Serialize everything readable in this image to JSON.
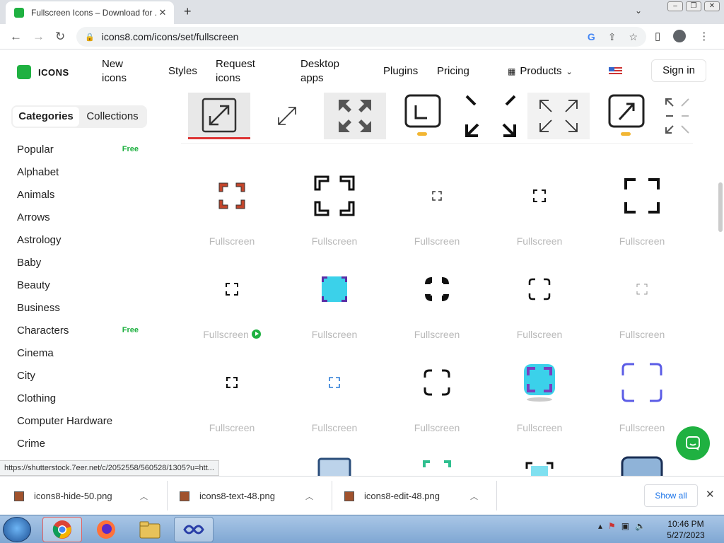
{
  "browser": {
    "tab_title": "Fullscreen Icons – Download for ...",
    "url": "icons8.com/icons/set/fullscreen"
  },
  "site": {
    "logo_text": "ICONS",
    "nav": {
      "new_icons": "New icons",
      "styles": "Styles",
      "request_icons": "Request icons",
      "desktop_apps": "Desktop apps",
      "plugins": "Plugins",
      "pricing": "Pricing",
      "products": "Products"
    },
    "sign_in": "Sign in"
  },
  "sidebar": {
    "tabs": [
      "Categories",
      "Collections"
    ],
    "categories": [
      {
        "label": "Popular",
        "badge": "Free"
      },
      {
        "label": "Alphabet",
        "badge": ""
      },
      {
        "label": "Animals",
        "badge": ""
      },
      {
        "label": "Arrows",
        "badge": ""
      },
      {
        "label": "Astrology",
        "badge": ""
      },
      {
        "label": "Baby",
        "badge": ""
      },
      {
        "label": "Beauty",
        "badge": ""
      },
      {
        "label": "Business",
        "badge": ""
      },
      {
        "label": "Characters",
        "badge": "Free"
      },
      {
        "label": "Cinema",
        "badge": ""
      },
      {
        "label": "City",
        "badge": ""
      },
      {
        "label": "Clothing",
        "badge": ""
      },
      {
        "label": "Computer Hardware",
        "badge": ""
      },
      {
        "label": "Crime",
        "badge": ""
      }
    ]
  },
  "grid": {
    "label": "Fullscreen",
    "rows": 3,
    "cols": 5
  },
  "status_url": "https://shutterstock.7eer.net/c/2052558/560528/1305?u=htt...",
  "downloads": {
    "items": [
      "icons8-hide-50.png",
      "icons8-text-48.png",
      "icons8-edit-48.png"
    ],
    "show_all": "Show all"
  },
  "taskbar": {
    "time": "10:46 PM",
    "date": "5/27/2023"
  }
}
